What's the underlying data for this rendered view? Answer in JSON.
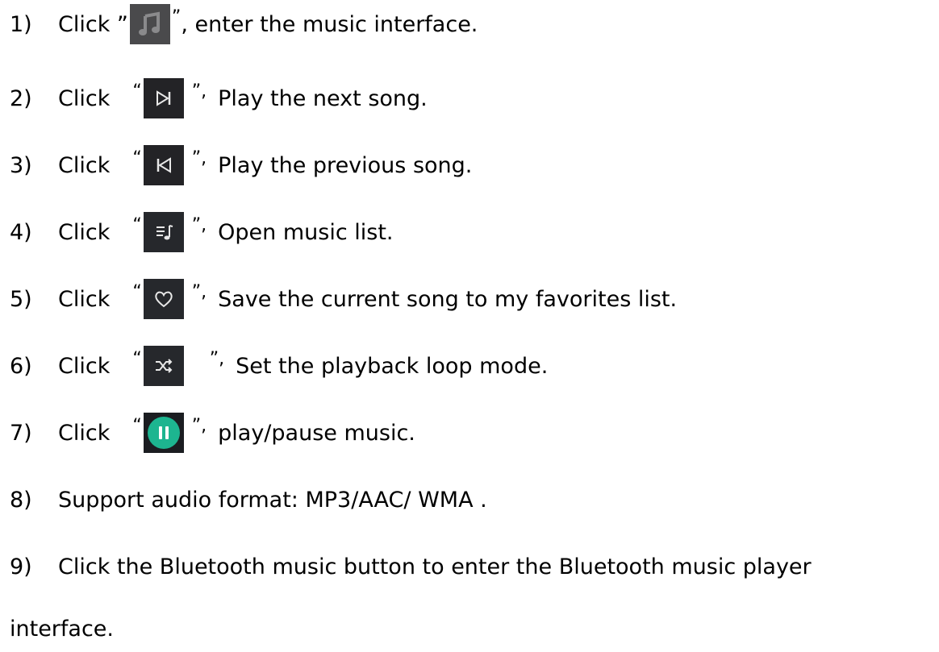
{
  "steps": [
    {
      "num": "1)",
      "click": "Click ”",
      "close": "”",
      "text": ", enter the music interface.",
      "icon": "music-note-icon"
    },
    {
      "num": "2)",
      "click": "Click",
      "open": "“",
      "close": "”,",
      "text": "Play the next song.",
      "icon": "next-track-icon"
    },
    {
      "num": "3)",
      "click": "Click",
      "open": "“",
      "close": "”,",
      "text": "Play the previous song.",
      "icon": "previous-track-icon"
    },
    {
      "num": "4)",
      "click": "Click",
      "open": "“",
      "close": "”,",
      "text": "Open music list.",
      "icon": "playlist-icon"
    },
    {
      "num": "5)",
      "click": "Click",
      "open": "“",
      "close": "”,",
      "text": "Save the current song to my favorites list.",
      "icon": "heart-icon"
    },
    {
      "num": "6)",
      "click": "Click",
      "open": "“",
      "close": "”,",
      "text": "Set the playback loop mode.",
      "icon": "shuffle-icon"
    },
    {
      "num": "7)",
      "click": "Click",
      "open": "“",
      "close": "”,",
      "text": "play/pause music.",
      "icon": "pause-circle-icon"
    }
  ],
  "step8": {
    "num": "8)",
    "text": "Support audio format: MP3/AAC/ WMA ."
  },
  "step9": {
    "num": "9)",
    "text": "Click the Bluetooth music button to enter the Bluetooth music player",
    "cont": "interface."
  },
  "colors": {
    "icon_bg": "#232326",
    "accent": "#1db590"
  }
}
